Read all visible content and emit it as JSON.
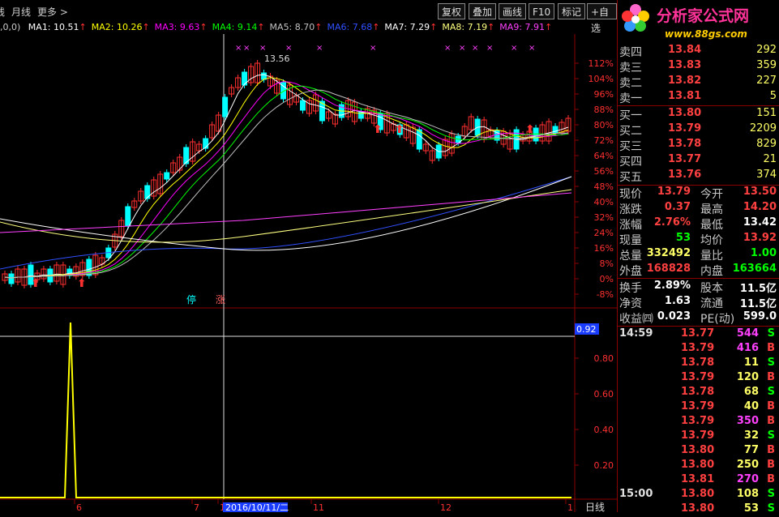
{
  "toolbar": {
    "left_items": [
      "线",
      "月线",
      "更多 >"
    ],
    "buttons": [
      "复权",
      "叠加",
      "画线",
      "F10",
      "标记",
      "+自选"
    ]
  },
  "ma_legend": {
    "prefix": ",0,0)",
    "items": [
      {
        "label": "MA1: 10.51",
        "color": "#ffffff"
      },
      {
        "label": "MA2: 10.26",
        "color": "#ffff00"
      },
      {
        "label": "MA3: 9.63",
        "color": "#ff00ff"
      },
      {
        "label": "MA4: 9.14",
        "color": "#00ff00"
      },
      {
        "label": "MA5: 8.70",
        "color": "#c0c0c0"
      },
      {
        "label": "MA6: 7.68",
        "color": "#3050ff"
      },
      {
        "label": "MA7: 7.29",
        "color": "#ffffff"
      },
      {
        "label": "MA8: 7.19",
        "color": "#ffff80"
      },
      {
        "label": "MA9: 7.91",
        "color": "#ff40ff"
      }
    ]
  },
  "main_chart": {
    "y_ticks": [
      "112%",
      "104%",
      "96%",
      "88%",
      "80%",
      "72%",
      "64%",
      "56%",
      "48%",
      "40%",
      "32%",
      "24%",
      "16%",
      "8%",
      "0%",
      "-8%"
    ],
    "high_label": "13.56",
    "markers": {
      "stop": "停",
      "rise": "涨"
    }
  },
  "sub_chart": {
    "current_value": "0.92",
    "y_ticks": [
      "0.80",
      "0.60",
      "0.40",
      "0.20"
    ]
  },
  "x_axis": {
    "labels": [
      "6",
      "7",
      "1",
      "2016/10/11/二",
      "11",
      "12",
      "1"
    ],
    "period": "日线"
  },
  "logo": {
    "title": "分析家公式网",
    "url": "www.88gs.com"
  },
  "order_book": {
    "asks": [
      {
        "label": "卖四",
        "price": "13.84",
        "vol": "292"
      },
      {
        "label": "卖三",
        "price": "13.83",
        "vol": "359"
      },
      {
        "label": "卖二",
        "price": "13.82",
        "vol": "227"
      },
      {
        "label": "卖一",
        "price": "13.81",
        "vol": "5"
      }
    ],
    "bids": [
      {
        "label": "买一",
        "price": "13.80",
        "vol": "151"
      },
      {
        "label": "买二",
        "price": "13.79",
        "vol": "2209"
      },
      {
        "label": "买三",
        "price": "13.78",
        "vol": "829"
      },
      {
        "label": "买四",
        "price": "13.77",
        "vol": "21"
      },
      {
        "label": "买五",
        "price": "13.76",
        "vol": "374"
      }
    ]
  },
  "stats": [
    {
      "k1": "现价",
      "v1": "13.79",
      "c1": "#ff4040",
      "k2": "今开",
      "v2": "13.50",
      "c2": "#ff4040"
    },
    {
      "k1": "涨跌",
      "v1": "0.37",
      "c1": "#ff4040",
      "k2": "最高",
      "v2": "14.20",
      "c2": "#ff4040"
    },
    {
      "k1": "涨幅",
      "v1": "2.76%",
      "c1": "#ff4040",
      "k2": "最低",
      "v2": "13.42",
      "c2": "#ffffff"
    },
    {
      "k1": "现量",
      "v1": "53",
      "c1": "#00ff00",
      "k2": "均价",
      "v2": "13.92",
      "c2": "#ff4040"
    },
    {
      "k1": "总量",
      "v1": "332492",
      "c1": "#ffff66",
      "k2": "量比",
      "v2": "1.00",
      "c2": "#00ff00"
    },
    {
      "k1": "外盘",
      "v1": "168828",
      "c1": "#ff4040",
      "k2": "内盘",
      "v2": "163664",
      "c2": "#00ff00"
    }
  ],
  "stats2": [
    {
      "k1": "换手",
      "v1": "2.89%",
      "k2": "股本",
      "v2": "11.5亿"
    },
    {
      "k1": "净资",
      "v1": "1.63",
      "k2": "流通",
      "v2": "11.5亿"
    },
    {
      "k1": "收益㈣",
      "v1": "0.023",
      "k2": "PE(动)",
      "v2": "599.0"
    }
  ],
  "ticks": [
    {
      "time": "14:59",
      "price": "13.77",
      "vol": "544",
      "vc": "#ff40ff",
      "side": "S",
      "sc": "#00ff00"
    },
    {
      "time": "",
      "price": "13.79",
      "vol": "416",
      "vc": "#ff40ff",
      "side": "B",
      "sc": "#ff4040"
    },
    {
      "time": "",
      "price": "13.78",
      "vol": "11",
      "vc": "#ffff66",
      "side": "S",
      "sc": "#00ff00"
    },
    {
      "time": "",
      "price": "13.79",
      "vol": "120",
      "vc": "#ffff66",
      "side": "B",
      "sc": "#ff4040"
    },
    {
      "time": "",
      "price": "13.78",
      "vol": "68",
      "vc": "#ffff66",
      "side": "S",
      "sc": "#00ff00"
    },
    {
      "time": "",
      "price": "13.79",
      "vol": "40",
      "vc": "#ffff66",
      "side": "B",
      "sc": "#ff4040"
    },
    {
      "time": "",
      "price": "13.79",
      "vol": "350",
      "vc": "#ff40ff",
      "side": "B",
      "sc": "#ff4040"
    },
    {
      "time": "",
      "price": "13.79",
      "vol": "32",
      "vc": "#ffff66",
      "side": "S",
      "sc": "#00ff00"
    },
    {
      "time": "",
      "price": "13.80",
      "vol": "77",
      "vc": "#ffff66",
      "side": "B",
      "sc": "#ff4040"
    },
    {
      "time": "",
      "price": "13.80",
      "vol": "250",
      "vc": "#ffff66",
      "side": "B",
      "sc": "#ff4040"
    },
    {
      "time": "",
      "price": "13.81",
      "vol": "270",
      "vc": "#ff40ff",
      "side": "B",
      "sc": "#ff4040"
    },
    {
      "time": "15:00",
      "price": "13.80",
      "vol": "108",
      "vc": "#ffff66",
      "side": "S",
      "sc": "#00ff00"
    },
    {
      "time": "",
      "price": "13.80",
      "vol": "53",
      "vc": "#ffff66",
      "side": "S",
      "sc": "#00ff00"
    }
  ],
  "colors": {
    "up": "#ff3030",
    "down": "#00ffff",
    "frame": "#8b0000"
  }
}
